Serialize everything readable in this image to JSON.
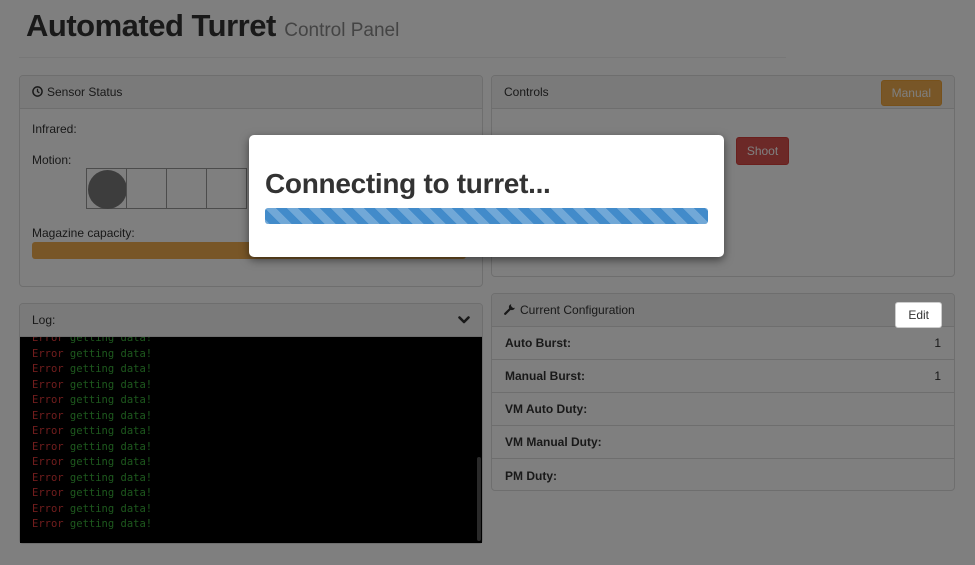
{
  "header": {
    "title": "Automated Turret",
    "subtitle": "Control Panel"
  },
  "sensor": {
    "heading": "Sensor Status",
    "heading_icon": "clock-icon",
    "infrared_label": "Infrared:",
    "motion_label": "Motion:",
    "motion_cells": 4,
    "motion_active_index": 0,
    "magazine_label": "Magazine capacity:",
    "magazine_color": "#f0ad4e"
  },
  "controls": {
    "heading": "Controls",
    "mode_button": "Manual",
    "shoot_button": "Shoot"
  },
  "log": {
    "heading": "Log:",
    "lines": [
      {
        "err": "Error",
        "msg": " getting data!"
      },
      {
        "err": "Error",
        "msg": " getting data!"
      },
      {
        "err": "Error",
        "msg": " getting data!"
      },
      {
        "err": "Error",
        "msg": " getting data!"
      },
      {
        "err": "Error",
        "msg": " getting data!"
      },
      {
        "err": "Error",
        "msg": " getting data!"
      },
      {
        "err": "Error",
        "msg": " getting data!"
      },
      {
        "err": "Error",
        "msg": " getting data!"
      },
      {
        "err": "Error",
        "msg": " getting data!"
      },
      {
        "err": "Error",
        "msg": " getting data!"
      },
      {
        "err": "Error",
        "msg": " getting data!"
      },
      {
        "err": "Error",
        "msg": " getting data!"
      },
      {
        "err": "Error",
        "msg": " getting data!"
      }
    ]
  },
  "config": {
    "heading": "Current Configuration",
    "heading_icon": "wrench-icon",
    "edit_button": "Edit",
    "rows": [
      {
        "label": "Auto Burst:",
        "value": "1"
      },
      {
        "label": "Manual Burst:",
        "value": "1"
      },
      {
        "label": "VM Auto Duty:",
        "value": ""
      },
      {
        "label": "VM Manual Duty:",
        "value": ""
      },
      {
        "label": "PM Duty:",
        "value": ""
      }
    ]
  },
  "modal": {
    "title": "Connecting to turret...",
    "progress_fraction": 1.0,
    "progress_color": "#428bca"
  }
}
